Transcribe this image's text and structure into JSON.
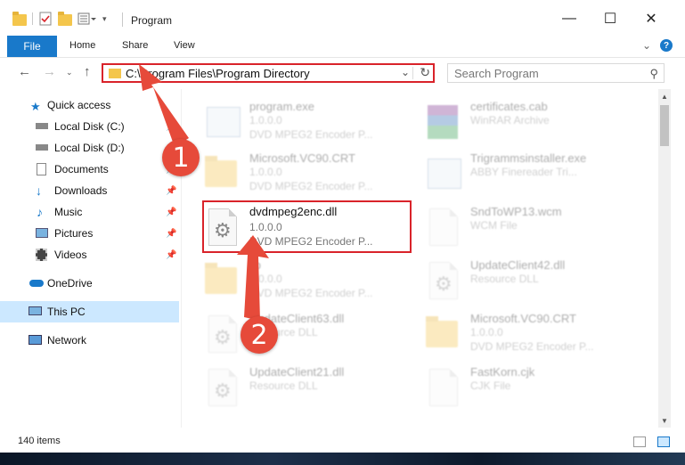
{
  "window": {
    "title": "Program",
    "controls": {
      "minimize": "—",
      "maximize": "☐",
      "close": "✕"
    }
  },
  "ribbon": {
    "tabs": [
      "File",
      "Home",
      "Share",
      "View"
    ],
    "expand_icon": "chevron-down-icon",
    "help_label": "?"
  },
  "navigation": {
    "address": "C:\\Program Files\\Program Directory",
    "search_placeholder": "Search Program"
  },
  "sidebar": {
    "items": [
      {
        "label": "Quick access",
        "icon": "star-icon",
        "pinned": false
      },
      {
        "label": "Local Disk (C:)",
        "icon": "drive-icon",
        "pinned": true
      },
      {
        "label": "Local Disk (D:)",
        "icon": "drive-icon",
        "pinned": true
      },
      {
        "label": "Documents",
        "icon": "documents-icon",
        "pinned": true
      },
      {
        "label": "Downloads",
        "icon": "downloads-icon",
        "pinned": true
      },
      {
        "label": "Music",
        "icon": "music-icon",
        "pinned": true
      },
      {
        "label": "Pictures",
        "icon": "pictures-icon",
        "pinned": true
      },
      {
        "label": "Videos",
        "icon": "videos-icon",
        "pinned": true
      },
      {
        "label": "OneDrive",
        "icon": "cloud-icon",
        "pinned": false
      },
      {
        "label": "This PC",
        "icon": "computer-icon",
        "pinned": false,
        "selected": true
      },
      {
        "label": "Network",
        "icon": "network-icon",
        "pinned": false
      }
    ]
  },
  "files": [
    {
      "name": "program.exe",
      "line2": "1.0.0.0",
      "line3": "DVD MPEG2 Encoder P...",
      "icon": "exe-icon"
    },
    {
      "name": "certificates.cab",
      "line2": "WinRAR Archive",
      "line3": "",
      "icon": "archive-icon"
    },
    {
      "name": "Microsoft.VC90.CRT",
      "line2": "1.0.0.0",
      "line3": "DVD MPEG2 Encoder P...",
      "icon": "folder-icon"
    },
    {
      "name": "Trigrammsinstaller.exe",
      "line2": "ABBY Finereader Tri...",
      "line3": "",
      "icon": "exe-icon"
    },
    {
      "name": "dvdmpeg2enc.dll",
      "line2": "1.0.0.0",
      "line3": "DVD MPEG2 Encoder P...",
      "icon": "dll-icon"
    },
    {
      "name": "SndToWP13.wcm",
      "line2": "WCM File",
      "line3": "",
      "icon": "file-icon"
    },
    {
      "name": "lib",
      "line2": "1.0.0.0",
      "line3": "DVD MPEG2 Encoder P...",
      "icon": "folder-icon"
    },
    {
      "name": "UpdateClient42.dll",
      "line2": "Resource DLL",
      "line3": "",
      "icon": "dll-icon"
    },
    {
      "name": "UpdateClient63.dll",
      "line2": "Resource DLL",
      "line3": "",
      "icon": "dll-icon"
    },
    {
      "name": "Microsoft.VC90.CRT",
      "line2": "1.0.0.0",
      "line3": "DVD MPEG2 Encoder P...",
      "icon": "folder-icon"
    },
    {
      "name": "UpdateClient21.dll",
      "line2": "Resource DLL",
      "line3": "",
      "icon": "dll-icon"
    },
    {
      "name": "FastKorn.cjk",
      "line2": "CJK File",
      "line3": "",
      "icon": "file-icon"
    }
  ],
  "status": {
    "item_count": "140 items"
  },
  "annotations": {
    "step1": "1",
    "step2": "2",
    "color": "#e64a3a",
    "box_color": "#d9232a"
  }
}
